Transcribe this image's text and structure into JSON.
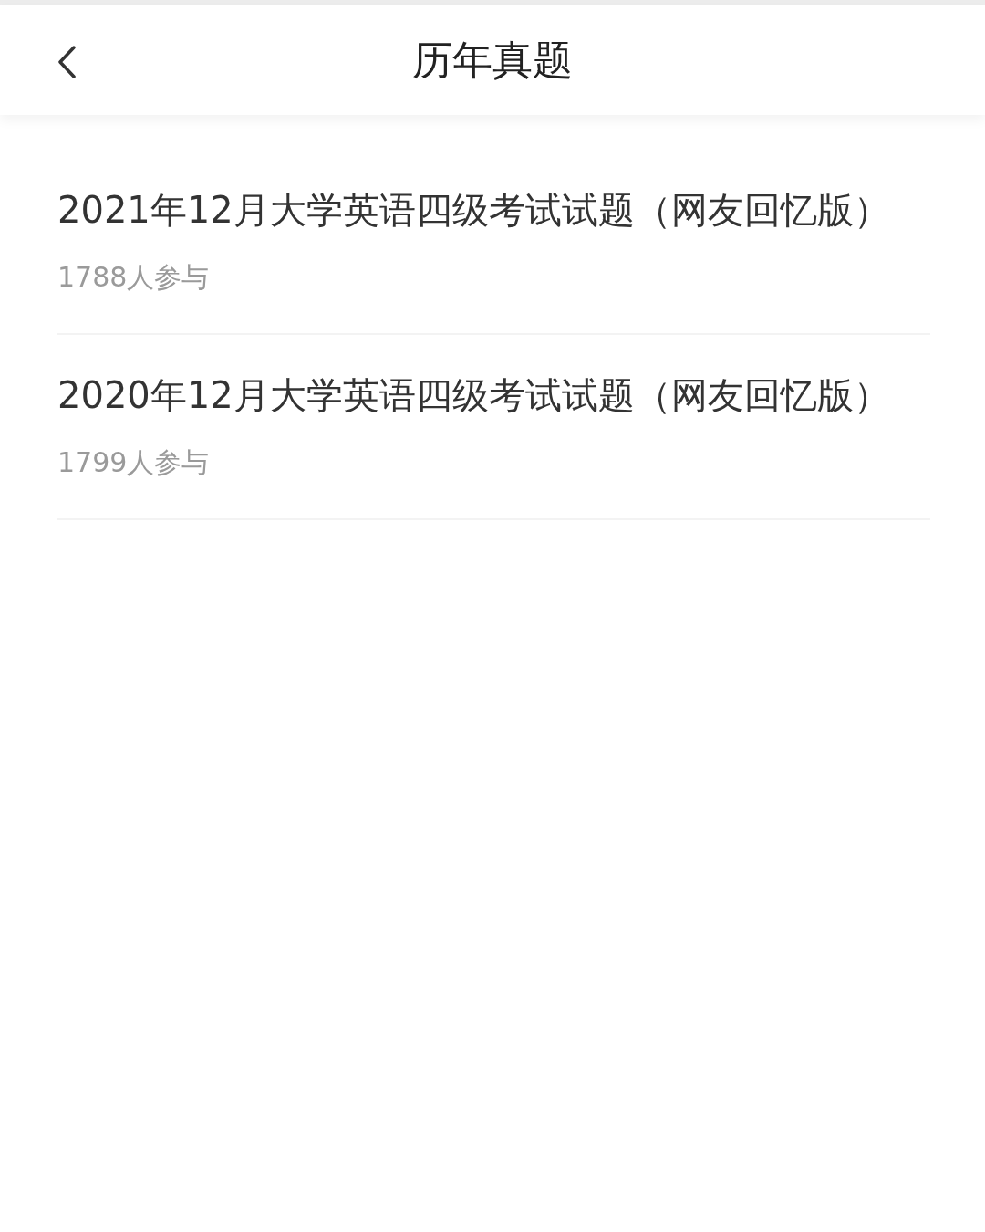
{
  "header": {
    "title": "历年真题"
  },
  "papers": [
    {
      "title": "2021年12月大学英语四级考试试题（网友回忆版）",
      "participants": "1788人参与"
    },
    {
      "title": "2020年12月大学英语四级考试试题（网友回忆版）",
      "participants": "1799人参与"
    }
  ]
}
